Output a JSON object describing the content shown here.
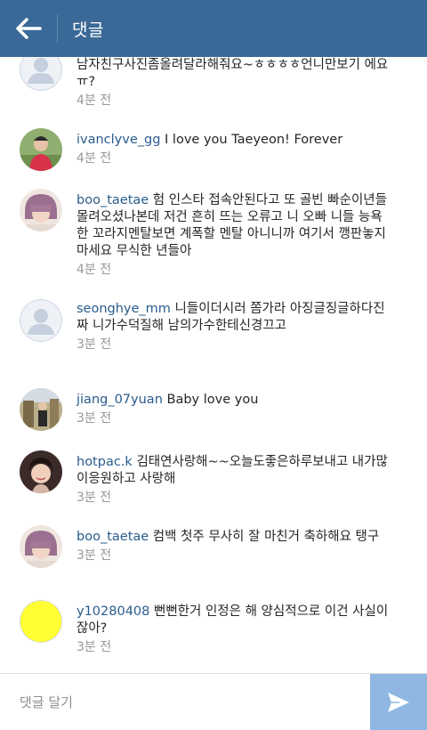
{
  "header": {
    "title": "댓글",
    "back_icon": "back-arrow-icon"
  },
  "comments": [
    {
      "username": "",
      "text": "남자친구사진좀올려달라해줘요~ㅎㅎㅎㅎ언니만보기 에요ㅠ?",
      "time": "4분 전",
      "avatar": "default-avatar"
    },
    {
      "username": "ivanclyve_gg",
      "text": "I love you Taeyeon! Forever",
      "time": "4분 전",
      "avatar": "photo-avatar"
    },
    {
      "username": "boo_taetae",
      "text": "험 인스타 접속안된다고 또 골빈 빠순이년들 몰려오셨나본데 저건 흔히 뜨는 오류고 니 오빠 니들 능욕한 꼬라지멘탈보면 계폭할 멘탈 아니니까 여기서 깽판놓지 마세요 무식한 년들아",
      "time": "4분 전",
      "avatar": "photo-avatar"
    },
    {
      "username": "seonghye_mm",
      "text": "니들이더시러 쫌가라 아징글징글하다진짜 니가수덕질해 남의가수한테신경끄고",
      "time": "3분 전",
      "avatar": "default-avatar"
    },
    {
      "username": "jiang_07yuan",
      "text": "Baby  love  you",
      "time": "3분 전",
      "avatar": "photo-avatar"
    },
    {
      "username": "hotpac.k",
      "text": "김태연사랑해~~오늘도좋은하루보내고 내가많이응원하고 사랑해",
      "time": "3분 전",
      "avatar": "photo-avatar"
    },
    {
      "username": "boo_taetae",
      "text": "컴백 첫주 무사히 잘 마친거 축하해요 탱구",
      "time": "3분 전",
      "avatar": "photo-avatar"
    },
    {
      "username": "y10280408",
      "text": "뻔뻔한거 인정은 해  양심적으로 이건 사실이잖아?",
      "time": "3분 전",
      "avatar": "yellow-avatar"
    }
  ],
  "input": {
    "placeholder": "댓글 달기",
    "value": "",
    "send_icon": "send-icon"
  },
  "colors": {
    "header_bg": "#3b6997",
    "username": "#2a5c8e",
    "send_bg": "#8fb7e2",
    "yellow_avatar": "#ffff33"
  }
}
